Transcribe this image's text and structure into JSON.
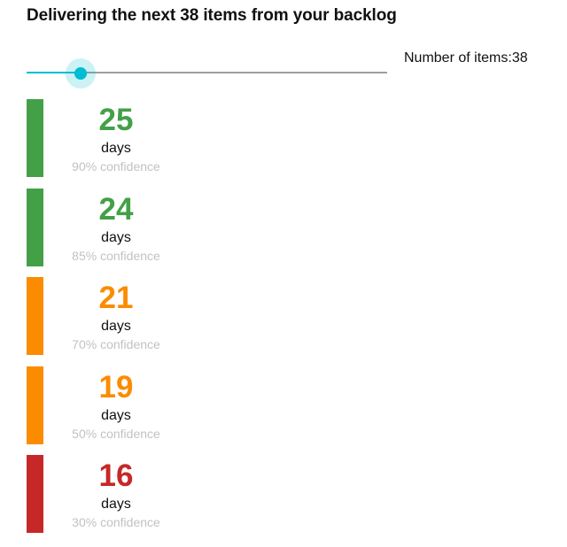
{
  "page": {
    "title": "Delivering the next 38 items from your backlog"
  },
  "slider": {
    "readout": "Number of items:38",
    "fill_fraction": 0.149,
    "accent_color": "#00bcd4",
    "rail_color": "#9e9e9e"
  },
  "forecasts": [
    {
      "days": "25",
      "unit": "days",
      "confidence": "90% confidence",
      "color": "#43a047"
    },
    {
      "days": "24",
      "unit": "days",
      "confidence": "85% confidence",
      "color": "#43a047"
    },
    {
      "days": "21",
      "unit": "days",
      "confidence": "70% confidence",
      "color": "#fb8c00"
    },
    {
      "days": "19",
      "unit": "days",
      "confidence": "50% confidence",
      "color": "#fb8c00"
    },
    {
      "days": "16",
      "unit": "days",
      "confidence": "30% confidence",
      "color": "#c62828"
    }
  ]
}
